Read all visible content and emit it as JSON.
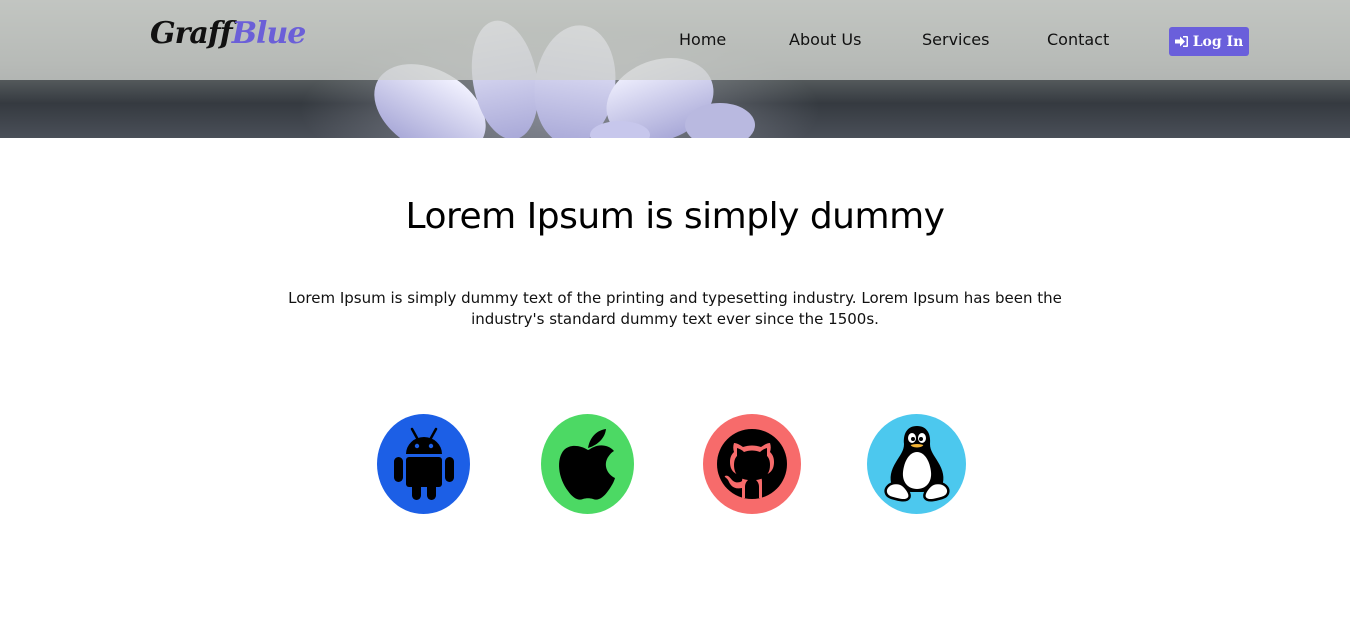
{
  "header": {
    "logo": {
      "part1": "Graff",
      "part2": "Blue"
    },
    "nav": [
      {
        "label": "Home"
      },
      {
        "label": "About Us"
      },
      {
        "label": "Services"
      },
      {
        "label": "Contact"
      }
    ],
    "login": {
      "label": "Log In",
      "icon": "sign-in-icon",
      "color": "#6a5fdb"
    }
  },
  "main": {
    "headline": "Lorem Ipsum is simply dummy",
    "description": "Lorem Ipsum is simply dummy text of the printing and typesetting industry. Lorem Ipsum has been the industry's standard dummy text ever since the 1500s."
  },
  "platforms": [
    {
      "icon": "android-icon",
      "color": "#1c5fe6"
    },
    {
      "icon": "apple-icon",
      "color": "#4cd964"
    },
    {
      "icon": "github-icon",
      "color": "#f76b6b"
    },
    {
      "icon": "linux-icon",
      "color": "#4cc8ee"
    }
  ]
}
